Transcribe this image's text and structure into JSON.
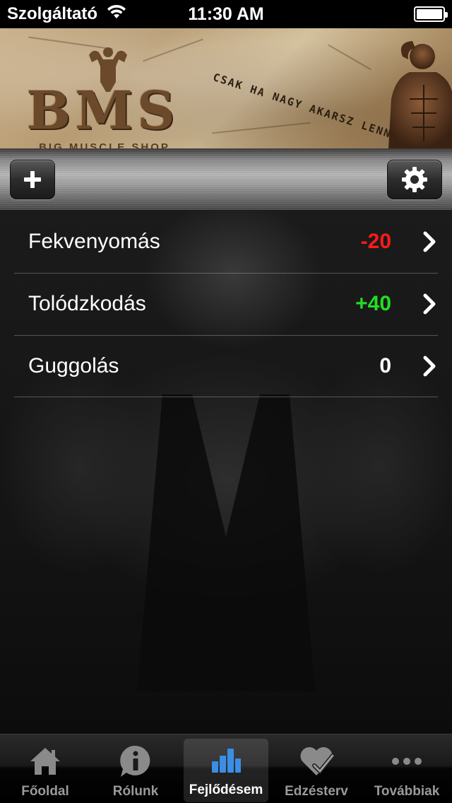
{
  "status_bar": {
    "carrier": "Szolgáltató",
    "time": "11:30 AM",
    "battery_level": 1.0
  },
  "banner": {
    "logo_text": "BMS",
    "logo_subtitle": "BIG MUSCLE SHOP",
    "slogan": "CSAK HA NAGY AKARSZ LENNI..."
  },
  "toolbar": {
    "add_icon": "plus-icon",
    "settings_icon": "gear-icon"
  },
  "exercises": [
    {
      "name": "Fekvenyomás",
      "value": "-20",
      "color": "#ff1a1a"
    },
    {
      "name": "Tolódzkodás",
      "value": "+40",
      "color": "#22dd22"
    },
    {
      "name": "Guggolás",
      "value": "0",
      "color": "#ffffff"
    }
  ],
  "tabs": [
    {
      "label": "Főoldal",
      "icon": "home-icon",
      "active": false
    },
    {
      "label": "Rólunk",
      "icon": "info-icon",
      "active": false
    },
    {
      "label": "Fejlődésem",
      "icon": "bar-chart-icon",
      "active": true
    },
    {
      "label": "Edzésterv",
      "icon": "heart-check-icon",
      "active": false
    },
    {
      "label": "Továbbiak",
      "icon": "more-icon",
      "active": false
    }
  ],
  "colors": {
    "active_tab_icon": "#3a8ee6",
    "inactive_tab": "#9a9a9a"
  }
}
